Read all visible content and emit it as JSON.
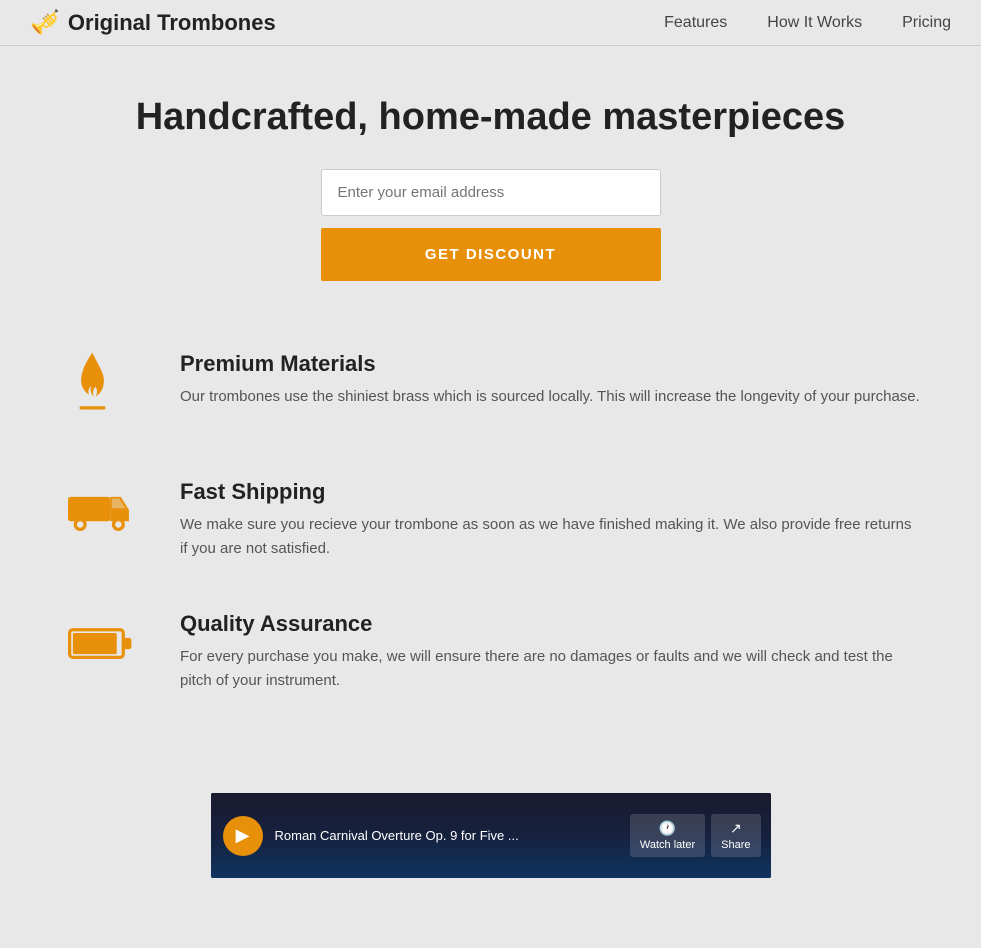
{
  "nav": {
    "logo_text": "Original Trombones",
    "links": [
      {
        "label": "Features",
        "id": "features"
      },
      {
        "label": "How It Works",
        "id": "how-it-works"
      },
      {
        "label": "Pricing",
        "id": "pricing"
      }
    ]
  },
  "hero": {
    "title": "Handcrafted, home-made masterpieces",
    "email_placeholder": "Enter your email address",
    "cta_label": "GET DISCOUNT"
  },
  "features": [
    {
      "id": "premium-materials",
      "icon": "flame",
      "title": "Premium Materials",
      "description": "Our trombones use the shiniest brass which is sourced locally. This will increase the longevity of your purchase."
    },
    {
      "id": "fast-shipping",
      "icon": "truck",
      "title": "Fast Shipping",
      "description": "We make sure you recieve your trombone as soon as we have finished making it. We also provide free returns if you are not satisfied."
    },
    {
      "id": "quality-assurance",
      "icon": "battery",
      "title": "Quality Assurance",
      "description": "For every purchase you make, we will ensure there are no damages or faults and we will check and test the pitch of your instrument."
    }
  ],
  "video": {
    "title": "Roman Carnival Overture Op. 9 for Five ...",
    "watch_later": "Watch later",
    "share": "Share"
  },
  "colors": {
    "accent": "#e8900a"
  }
}
